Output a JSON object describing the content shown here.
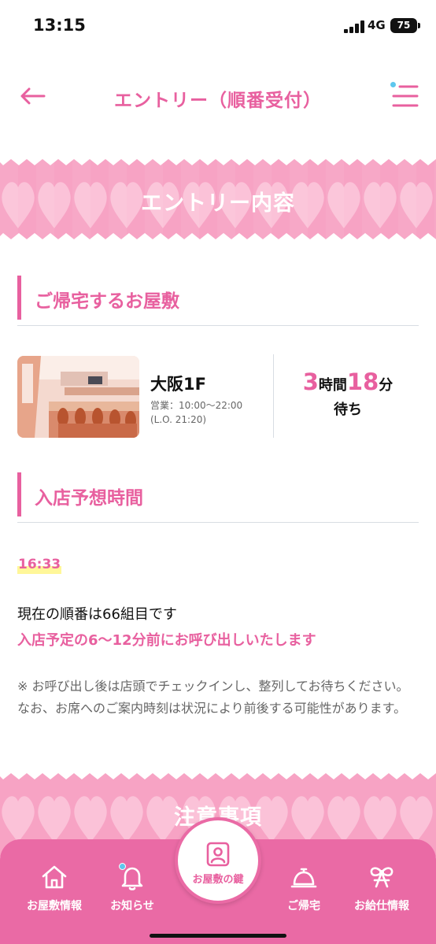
{
  "status_bar": {
    "time": "13:15",
    "network": "4G",
    "battery": "75"
  },
  "header": {
    "title": "エントリー（順番受付）"
  },
  "banner_entry": {
    "title": "エントリー内容"
  },
  "section_mansion": {
    "title": "ご帰宅するお屋敷"
  },
  "mansion": {
    "name": "大阪1F",
    "hours": "営業：10:00〜22:00",
    "last_order": "(L.O. 21:20)",
    "wait_hours": "3",
    "wait_hours_unit": "時間",
    "wait_minutes": "18",
    "wait_minutes_unit": "分",
    "wait_label": "待ち"
  },
  "section_time": {
    "title": "入店予想時間"
  },
  "entry": {
    "time": "16:33",
    "queue_text": "現在の順番は66組目です",
    "call_text": "入店予定の6〜12分前にお呼び出しいたします",
    "note": "※ お呼び出し後は店頭でチェックインし、整列してお待ちください。なお、お席へのご案内時刻は状況により前後する可能性があります。"
  },
  "banner_notes": {
    "title": "注意事項"
  },
  "bottom_nav": {
    "items": [
      {
        "label": "お屋敷情報",
        "icon": "house-icon"
      },
      {
        "label": "お知らせ",
        "icon": "bell-icon"
      },
      {
        "label": "お屋敷の鍵",
        "icon": "member-card-icon"
      },
      {
        "label": "ご帰宅",
        "icon": "service-bell-icon"
      },
      {
        "label": "お給仕情報",
        "icon": "bow-icon"
      }
    ]
  },
  "colors": {
    "accent": "#e8609f",
    "nav_bg": "#ea6aa5",
    "banner_bg": "#f7a3c4",
    "notify_dot": "#5ec7ee"
  }
}
